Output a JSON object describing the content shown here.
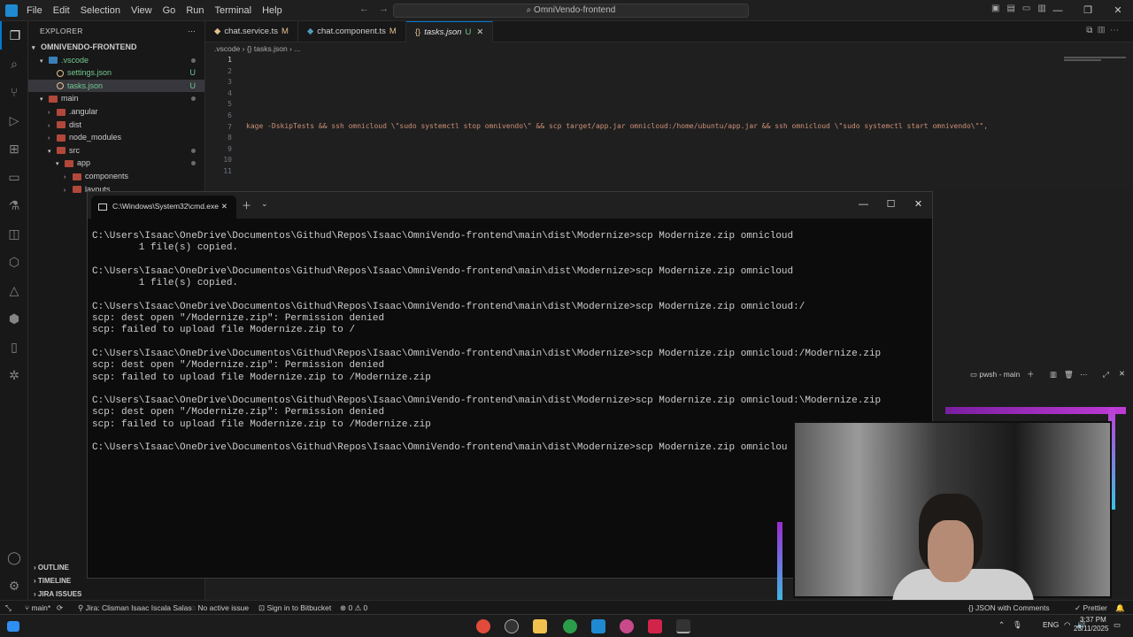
{
  "titlebar": {
    "menu": [
      "File",
      "Edit",
      "Selection",
      "View",
      "Go",
      "Run",
      "Terminal",
      "Help"
    ],
    "search": "OmniVendo-frontend",
    "window_controls": [
      "—",
      "❐",
      "✕"
    ]
  },
  "sidebar": {
    "header": "EXPLORER",
    "root": "OMNIVENDO-FRONTEND",
    "tree": [
      {
        "label": ".vscode",
        "type": "folder",
        "indent": 1,
        "open": true,
        "cls": "f-green"
      },
      {
        "label": "settings.json",
        "type": "file",
        "indent": 2,
        "status": "U",
        "cls": "f-green"
      },
      {
        "label": "tasks.json",
        "type": "file",
        "indent": 2,
        "status": "U",
        "cls": "f-green",
        "selected": true
      },
      {
        "label": "main",
        "type": "folder",
        "indent": 1,
        "open": true
      },
      {
        "label": ".angular",
        "type": "folder",
        "indent": 2
      },
      {
        "label": "dist",
        "type": "folder",
        "indent": 2
      },
      {
        "label": "node_modules",
        "type": "folder",
        "indent": 2
      },
      {
        "label": "src",
        "type": "folder",
        "indent": 2,
        "open": true
      },
      {
        "label": "app",
        "type": "folder",
        "indent": 3,
        "open": true
      },
      {
        "label": "components",
        "type": "folder",
        "indent": 4
      },
      {
        "label": "layouts",
        "type": "folder",
        "indent": 4
      }
    ],
    "sections": [
      "OUTLINE",
      "TIMELINE",
      "JIRA ISSUES"
    ]
  },
  "tabs": [
    {
      "label": "chat.service.ts",
      "status": "M"
    },
    {
      "label": "chat.component.ts",
      "status": "M"
    },
    {
      "label": "tasks.json",
      "status": "U",
      "active": true
    }
  ],
  "breadcrumb": ".vscode  ›  {} tasks.json  ›  ...",
  "editor": {
    "line_numbers": [
      "1",
      "2",
      "3",
      "4",
      "5",
      "6",
      "7",
      "8",
      "9",
      "10",
      "11"
    ],
    "code_line_7": "kage -DskipTests && ssh omnicloud \\\"sudo systemctl stop omnivendo\\\" && scp target/app.jar omnicloud:/home/ubuntu/app.jar && ssh omnicloud \\\"sudo systemctl start omnivendo\\\"\","
  },
  "panel": {
    "terminal_label": "pwsh - main"
  },
  "cmd": {
    "tab_title": "C:\\Windows\\System32\\cmd.exe",
    "lines": [
      "C:\\Users\\Isaac\\OneDrive\\Documentos\\Githud\\Repos\\Isaac\\OmniVendo-frontend\\main\\dist\\Modernize>scp Modernize.zip omnicloud",
      "        1 file(s) copied.",
      "",
      "C:\\Users\\Isaac\\OneDrive\\Documentos\\Githud\\Repos\\Isaac\\OmniVendo-frontend\\main\\dist\\Modernize>scp Modernize.zip omnicloud",
      "        1 file(s) copied.",
      "",
      "C:\\Users\\Isaac\\OneDrive\\Documentos\\Githud\\Repos\\Isaac\\OmniVendo-frontend\\main\\dist\\Modernize>scp Modernize.zip omnicloud:/",
      "scp: dest open \"/Modernize.zip\": Permission denied",
      "scp: failed to upload file Modernize.zip to /",
      "",
      "C:\\Users\\Isaac\\OneDrive\\Documentos\\Githud\\Repos\\Isaac\\OmniVendo-frontend\\main\\dist\\Modernize>scp Modernize.zip omnicloud:/Modernize.zip",
      "scp: dest open \"/Modernize.zip\": Permission denied",
      "scp: failed to upload file Modernize.zip to /Modernize.zip",
      "",
      "C:\\Users\\Isaac\\OneDrive\\Documentos\\Githud\\Repos\\Isaac\\OmniVendo-frontend\\main\\dist\\Modernize>scp Modernize.zip omnicloud:\\Modernize.zip",
      "scp: dest open \"/Modernize.zip\": Permission denied",
      "scp: failed to upload file Modernize.zip to /Modernize.zip",
      "",
      "C:\\Users\\Isaac\\OneDrive\\Documentos\\Githud\\Repos\\Isaac\\OmniVendo-frontend\\main\\dist\\Modernize>scp Modernize.zip omniclou"
    ]
  },
  "statusbar": {
    "branch": "main*",
    "jira": "Jira: Clisman Isaac Iscala Salas",
    "issue": "No active issue",
    "bitbucket": "Sign in to Bitbucket",
    "problems": "⊗ 0 ⚠ 0",
    "language": "JSON with Comments",
    "prettier": "✓ Prettier"
  },
  "taskbar": {
    "lang": "ENG",
    "time": "3:37 PM",
    "date": "23/11/2025"
  }
}
